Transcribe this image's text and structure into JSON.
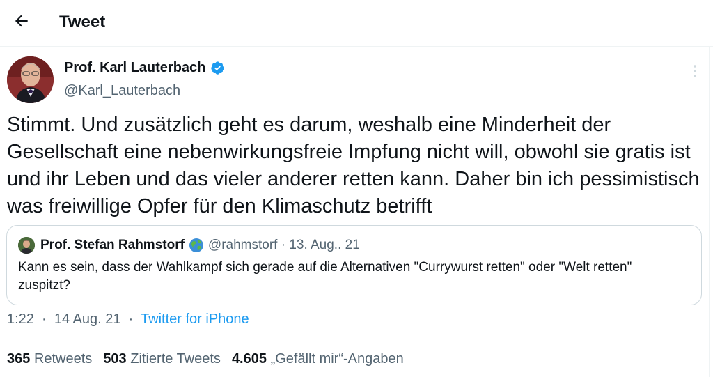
{
  "header": {
    "title": "Tweet"
  },
  "tweet": {
    "author_name": "Prof. Karl Lauterbach",
    "author_handle": "@Karl_Lauterbach",
    "text": "Stimmt. Und zusätzlich geht es darum, weshalb eine Minderheit der Gesellschaft eine nebenwirkungsfreie Impfung nicht will, obwohl sie gratis ist und ihr Leben und das vieler anderer retten kann. Daher bin ich pessimistisch was freiwillige Opfer für den Klimaschutz betrifft",
    "time": "1:22",
    "date": "14 Aug. 21",
    "source": "Twitter for iPhone"
  },
  "quote": {
    "author_name": "Prof. Stefan Rahmstorf",
    "author_handle": "@rahmstorf",
    "date": "13. Aug.. 21",
    "text": "Kann es sein, dass der Wahlkampf sich gerade auf die Alternativen \"Currywurst retten\" oder \"Welt retten\" zuspitzt?"
  },
  "stats": {
    "retweets_count": "365",
    "retweets_label": "Retweets",
    "quotes_count": "503",
    "quotes_label": "Zitierte Tweets",
    "likes_count": "4.605",
    "likes_label": "„Gefällt mir“-Angaben"
  },
  "colors": {
    "accent": "#1d9bf0",
    "secondary_text": "#536471",
    "text": "#0f1419",
    "border": "#cfd9de"
  }
}
